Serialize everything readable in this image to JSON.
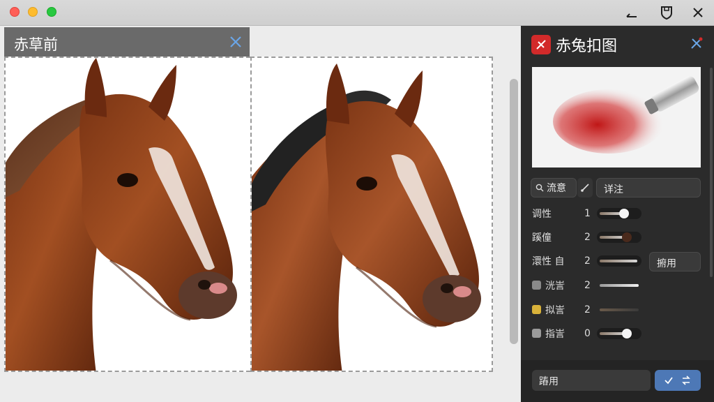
{
  "window": {
    "traffic_lights": [
      "close",
      "minimize",
      "zoom"
    ],
    "controls": [
      "minimize-icon",
      "shield-icon",
      "close-icon"
    ]
  },
  "left_pane": {
    "tab_title": "赤草前",
    "images": [
      {
        "name": "before",
        "subject": "horse head, original"
      },
      {
        "name": "after",
        "subject": "horse head, mane recolored dark"
      }
    ]
  },
  "right_panel": {
    "title": "赤兔扣图",
    "search_chip": "流意",
    "name_field": "详注",
    "rows": [
      {
        "label": "调性",
        "value": "1",
        "swatch": null,
        "slider": 0.6
      },
      {
        "label": "蹊僮",
        "value": "2",
        "swatch": null,
        "slider": 0.7
      },
      {
        "label": "澴性 自",
        "value": "2",
        "swatch": null,
        "slider": 0.9
      },
      {
        "label": "洸訔",
        "value": "2",
        "swatch": "#8a8a8a",
        "slider": 0.9
      },
      {
        "label": "拟訔",
        "value": "2",
        "swatch": "#d9b23a",
        "slider": 0.2
      },
      {
        "label": "指訔",
        "value": "0",
        "swatch": "#9a9a9a",
        "slider": 0.65
      }
    ],
    "apply_small": "捬用",
    "footer_field": "蹖用",
    "colors": {
      "accent": "#d22a2a",
      "confirm": "#4d78b6",
      "panel": "#2b2b2b"
    }
  }
}
